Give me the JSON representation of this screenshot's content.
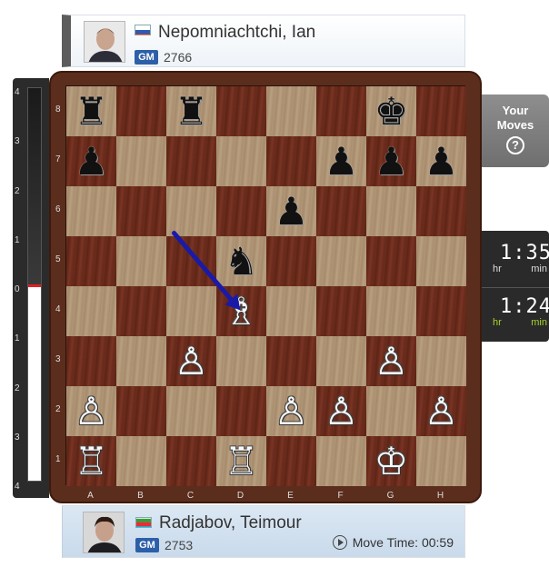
{
  "players": {
    "top": {
      "name": "Nepomniachtchi, Ian",
      "title": "GM",
      "rating": "2766",
      "flag": "RUS"
    },
    "bottom": {
      "name": "Radjabov, Teimour",
      "title": "GM",
      "rating": "2753",
      "flag": "AZE",
      "move_time_label": "Move Time: 00:59"
    }
  },
  "sidebar": {
    "your_moves_label": "Your Moves",
    "help_glyph": "?"
  },
  "clocks": {
    "top": {
      "time": "1:35",
      "hr": "hr",
      "min": "min"
    },
    "bottom": {
      "time": "1:24",
      "hr": "hr",
      "min": "min",
      "active": true
    }
  },
  "eval_bar": {
    "ticks_top": [
      "4",
      "3",
      "2",
      "1",
      "0"
    ],
    "ticks_bottom": [
      "1",
      "2",
      "3",
      "4"
    ],
    "value": 0
  },
  "board": {
    "files": [
      "A",
      "B",
      "C",
      "D",
      "E",
      "F",
      "G",
      "H"
    ],
    "ranks": [
      "8",
      "7",
      "6",
      "5",
      "4",
      "3",
      "2",
      "1"
    ],
    "pieces": [
      {
        "sq": "a8",
        "glyph": "♜",
        "color": "b"
      },
      {
        "sq": "c8",
        "glyph": "♜",
        "color": "b"
      },
      {
        "sq": "g8",
        "glyph": "♚",
        "color": "b"
      },
      {
        "sq": "a7",
        "glyph": "♟",
        "color": "b"
      },
      {
        "sq": "f7",
        "glyph": "♟",
        "color": "b"
      },
      {
        "sq": "g7",
        "glyph": "♟",
        "color": "b"
      },
      {
        "sq": "h7",
        "glyph": "♟",
        "color": "b"
      },
      {
        "sq": "e6",
        "glyph": "♟",
        "color": "b"
      },
      {
        "sq": "d5",
        "glyph": "♞",
        "color": "b"
      },
      {
        "sq": "d4",
        "glyph": "♗",
        "color": "w"
      },
      {
        "sq": "c3",
        "glyph": "♙",
        "color": "w"
      },
      {
        "sq": "g3",
        "glyph": "♙",
        "color": "w"
      },
      {
        "sq": "a2",
        "glyph": "♙",
        "color": "w"
      },
      {
        "sq": "e2",
        "glyph": "♙",
        "color": "w"
      },
      {
        "sq": "f2",
        "glyph": "♙",
        "color": "w"
      },
      {
        "sq": "h2",
        "glyph": "♙",
        "color": "w"
      },
      {
        "sq": "a1",
        "glyph": "♖",
        "color": "w"
      },
      {
        "sq": "d1",
        "glyph": "♖",
        "color": "w"
      },
      {
        "sq": "g1",
        "glyph": "♔",
        "color": "w"
      }
    ],
    "arrow": {
      "from": "c5",
      "to": "d4",
      "color": "#1a1aa8"
    }
  },
  "colors": {
    "board_frame": "#5b2d1c",
    "eval_zero": "#e02020",
    "active_clock": "#a6d12a",
    "gm_badge": "#2d5fa8"
  }
}
